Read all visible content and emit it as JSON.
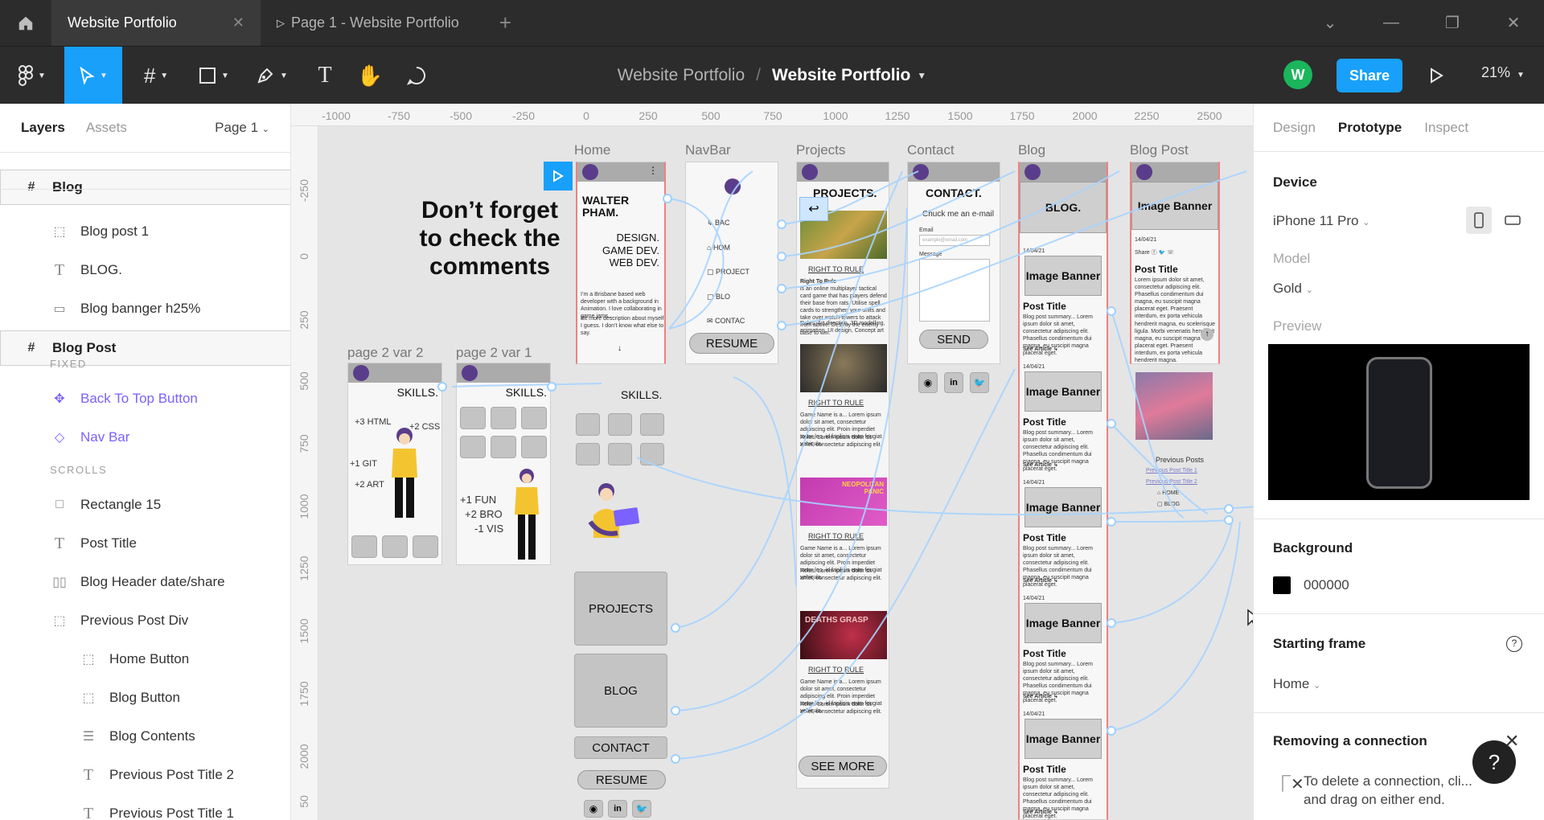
{
  "titlebar": {
    "tabs": [
      {
        "label": "Website Portfolio"
      },
      {
        "label": "Page 1 - Website Portfolio"
      }
    ]
  },
  "toolbar": {
    "breadcrumb_project": "Website Portfolio",
    "breadcrumb_file": "Website Portfolio",
    "avatar_letter": "W",
    "share_label": "Share",
    "zoom": "21%"
  },
  "left_panel": {
    "tab_layers": "Layers",
    "tab_assets": "Assets",
    "page_selector": "Page 1",
    "layers": [
      {
        "label": "Blog"
      },
      {
        "label": "Blog post 1"
      },
      {
        "label": "BLOG."
      },
      {
        "label": "Blog bannger h25%"
      },
      {
        "label": "Blog Post"
      },
      {
        "label": "Back To Top Button"
      },
      {
        "label": "Nav Bar"
      },
      {
        "label": "Rectangle 15"
      },
      {
        "label": "Post Title"
      },
      {
        "label": "Blog Header date/share"
      },
      {
        "label": "Previous Post Div"
      },
      {
        "label": "Home Button"
      },
      {
        "label": "Blog Button"
      },
      {
        "label": "Blog Contents"
      },
      {
        "label": "Previous Post Title 2"
      },
      {
        "label": "Previous Post Title 1"
      }
    ],
    "section_fixed": "FIXED",
    "section_scrolls": "SCROLLS"
  },
  "canvas": {
    "ruler_top": [
      "-1000",
      "-750",
      "-500",
      "-250",
      "0",
      "250",
      "500",
      "750",
      "1000",
      "1250",
      "1500",
      "1750",
      "2000",
      "2250",
      "2500"
    ],
    "ruler_left": [
      "-250",
      "0",
      "250",
      "500",
      "750",
      "1000",
      "1250",
      "1500",
      "1750",
      "2000",
      "50"
    ],
    "frame_labels": {
      "home": "Home",
      "navbar": "NavBar",
      "projects": "Projects",
      "contact": "Contact",
      "blog": "Blog",
      "blog_post": "Blog Post",
      "page2var2": "page 2 var 2",
      "page2var1": "page 2 var 1"
    },
    "reminder": "Don’t forget to check the comments",
    "home": {
      "name": "WALTER PHAM.",
      "roles": "DESIGN. GAME DEV. WEB DEV.",
      "intro": "I’m a Brisbane based web developer with a background in Animation. I love collaborating in game jams...",
      "intro2": "Bit more description about myself I guess. I don’t know what else to say.",
      "skills": "SKILLS.",
      "projects_btn": "PROJECTS",
      "blog_btn": "BLOG",
      "contact_btn": "CONTACT",
      "resume_btn": "RESUME"
    },
    "navbar": {
      "items": [
        "BAC",
        "HOM",
        "PROJECT",
        "BLO",
        "CONTAC"
      ],
      "resume": "RESUME"
    },
    "projects": {
      "title": "PROJECTS.",
      "link": "RIGHT TO RULE",
      "desc_bold": "Right To Rule",
      "desc": "is an online multiplayer tactical card game that has players defend their base from rats. Utilise spell cards to strengthen your units and take over watch-towers to attack from above. Destroy the enemy base to win.",
      "roles": "Roles: Art direction, 3D modelling, animation, UI design, Concept art",
      "game_desc": "Game Name is a... Lorem ipsum dolor sit amet, consectetur adipiscing elit. Proin imperdiet tortor leo, id facilisis enim feugiat vehicula.",
      "roles2": "Roles: Lorem ipsum dolor sit amet, consectetur adipiscing elit.",
      "neo": "NEOPOLITAN PANIC",
      "deaths": "DEATHS GRASP",
      "see_more": "SEE MORE"
    },
    "contact": {
      "title": "CONTACT.",
      "subtitle": "Chuck me an e-mail",
      "email_label": "Email",
      "email_placeholder": "example@email.com",
      "message_label": "Message",
      "send": "SEND"
    },
    "blog": {
      "title": "BLOG.",
      "banner": "Image Banner",
      "date": "14/04/21",
      "post_title": "Post Title",
      "summary": "Blog post summary... Lorem ipsum dolor sit amet, consectetur adipiscing elit. Phasellus condimentum dui magna, eu suscipit magna placerat eget.",
      "see_article": "See Article ↳"
    },
    "blog_post": {
      "banner": "Image Banner",
      "date": "14/04/21",
      "share": "Share",
      "post_title": "Post Title",
      "body": "Lorem ipsum dolor sit amet, consectetur adipiscing elit. Phasellus condimentum dui magna, eu suscipit magna placerat eget. Praesent interdum, ex porta vehicula hendrerit magna, eu scelerisque ligula. Morbi venenatis hendrerit magna, eu suscipit magna placerat eget. Praesent interdum, ex porta vehicula hendrerit magna.",
      "prev_title": "Previous Posts",
      "prev1": "Previous Post Title 1",
      "prev2": "Previous Post Title 2",
      "home": "HOME",
      "blog": "BLOG"
    },
    "var2": {
      "skills": "SKILLS.",
      "html": "+3 HTML",
      "css": "+2 CSS",
      "git": "+1 GIT",
      "art": "+2 ART"
    },
    "var1": {
      "skills": "SKILLS.",
      "fun": "+1 FUN",
      "bro": "+2 BRO",
      "vis": "-1 VIS"
    }
  },
  "right_panel": {
    "tabs": [
      "Design",
      "Prototype",
      "Inspect"
    ],
    "device_heading": "Device",
    "device": "iPhone 11 Pro",
    "model_label": "Model",
    "model": "Gold",
    "preview_label": "Preview",
    "background_heading": "Background",
    "background_hex": "000000",
    "starting_frame_heading": "Starting frame",
    "starting_frame": "Home",
    "removing_heading": "Removing a connection",
    "removing_text": "To delete a connection, cli... and drag on either end.",
    "help": "?"
  },
  "colors": {
    "accent": "#18a0fb",
    "avatar": "#1bb55c",
    "connector": "#9fd0ff",
    "component_purple": "#7b61ff"
  }
}
